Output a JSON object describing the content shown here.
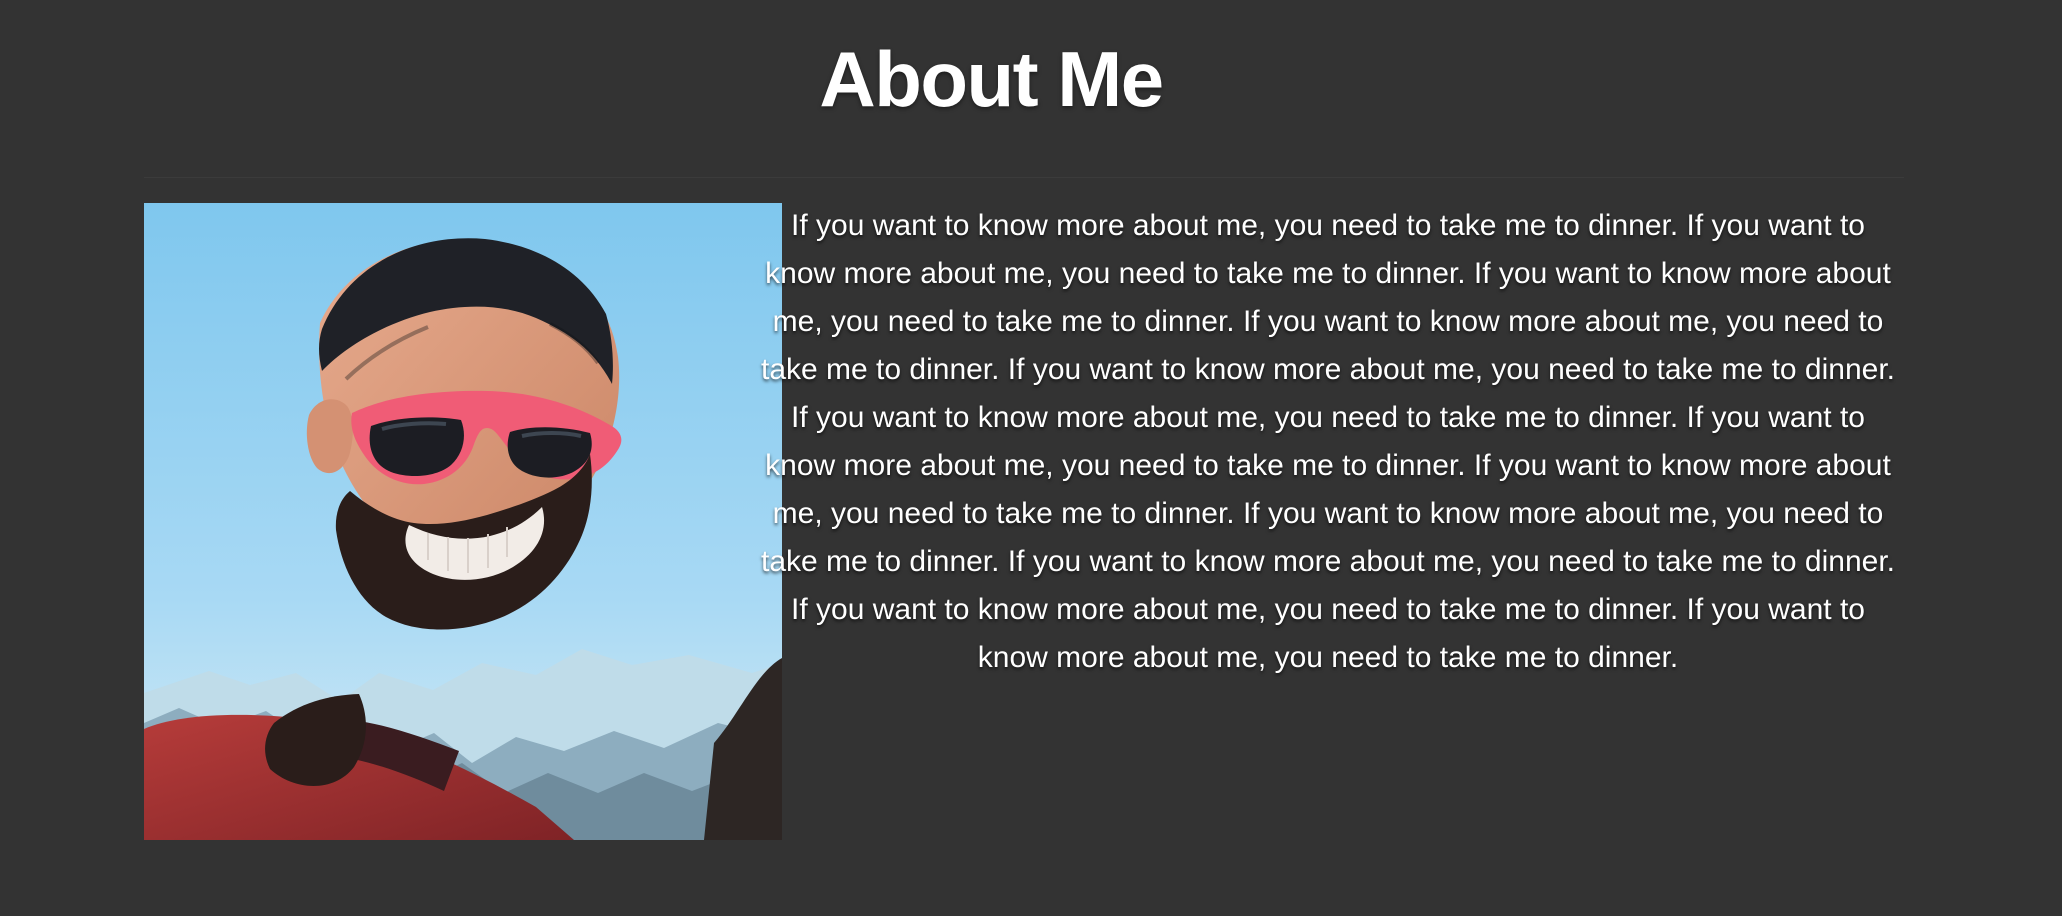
{
  "header": {
    "title": "About Me"
  },
  "profile": {
    "photo_icon": "profile-photo",
    "bio": "If you want to know more about me, you need to take me to dinner. If you want to know more about me, you need to take me to dinner. If you want to know more about me, you need to take me to dinner. If you want to know more about me, you need to take me to dinner. If you want to know more about me, you need to take me to dinner. If you want to know more about me, you need to take me to dinner. If you want to know more about me, you need to take me to dinner. If you want to know more about me, you need to take me to dinner. If you want to know more about me, you need to take me to dinner. If you want to know more about me, you need to take me to dinner. If you want to know more about me, you need to take me to dinner. If you want to know more about me, you need to take me to dinner."
  },
  "colors": {
    "background": "#333333",
    "text": "#ffffff",
    "divider": "#3b3b3b"
  }
}
